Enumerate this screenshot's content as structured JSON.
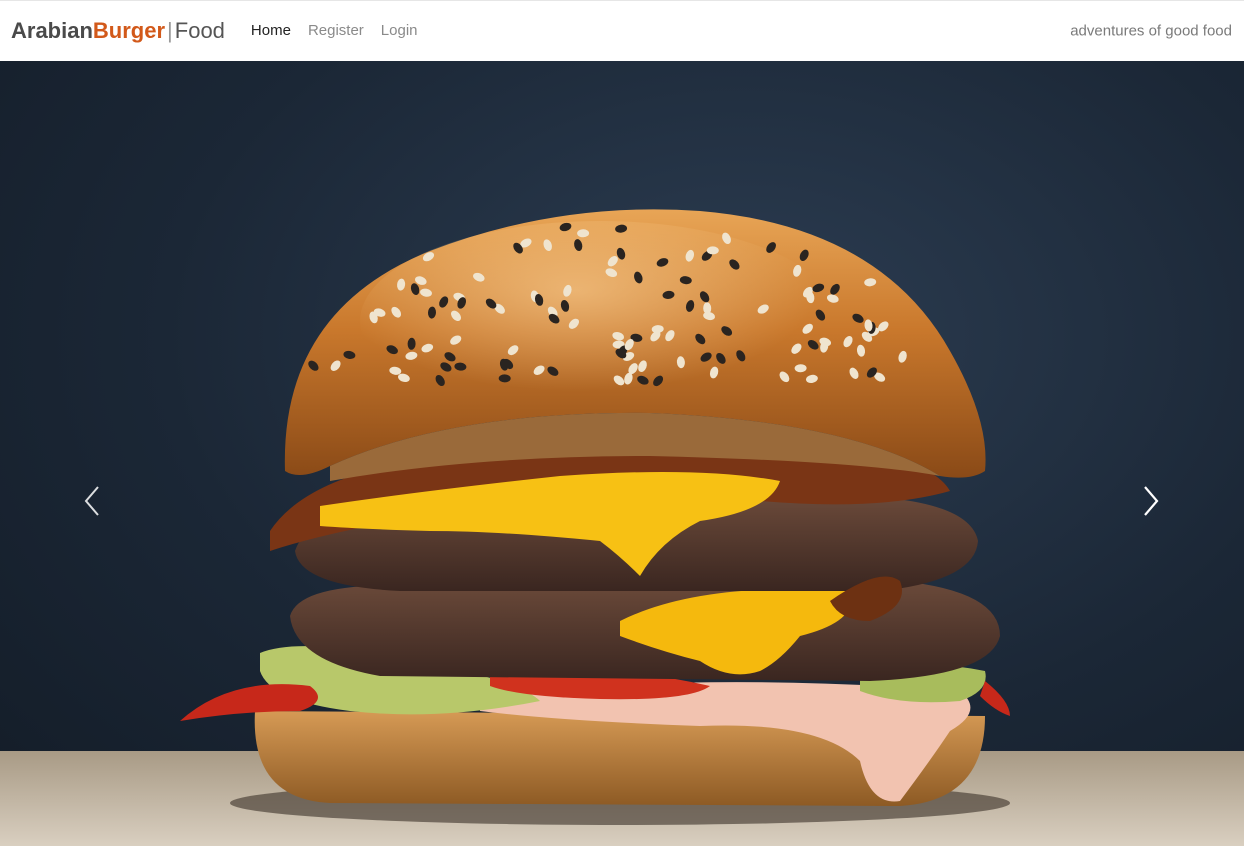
{
  "brand": {
    "part1": "Arabian",
    "part2": "Burger",
    "separator": "|",
    "part3": "Food"
  },
  "nav": {
    "items": [
      {
        "label": "Home"
      },
      {
        "label": "Register"
      },
      {
        "label": "Login"
      }
    ]
  },
  "tagline": "adventures of good food",
  "carousel": {
    "slide_image": "burger-photo",
    "prev_icon": "chevron-left-icon",
    "next_icon": "chevron-right-icon"
  },
  "colors": {
    "brand_accent": "#d2591a",
    "nav_active": "#222222",
    "nav_inactive": "#8a8a8a",
    "background_dark": "#1b2736"
  }
}
